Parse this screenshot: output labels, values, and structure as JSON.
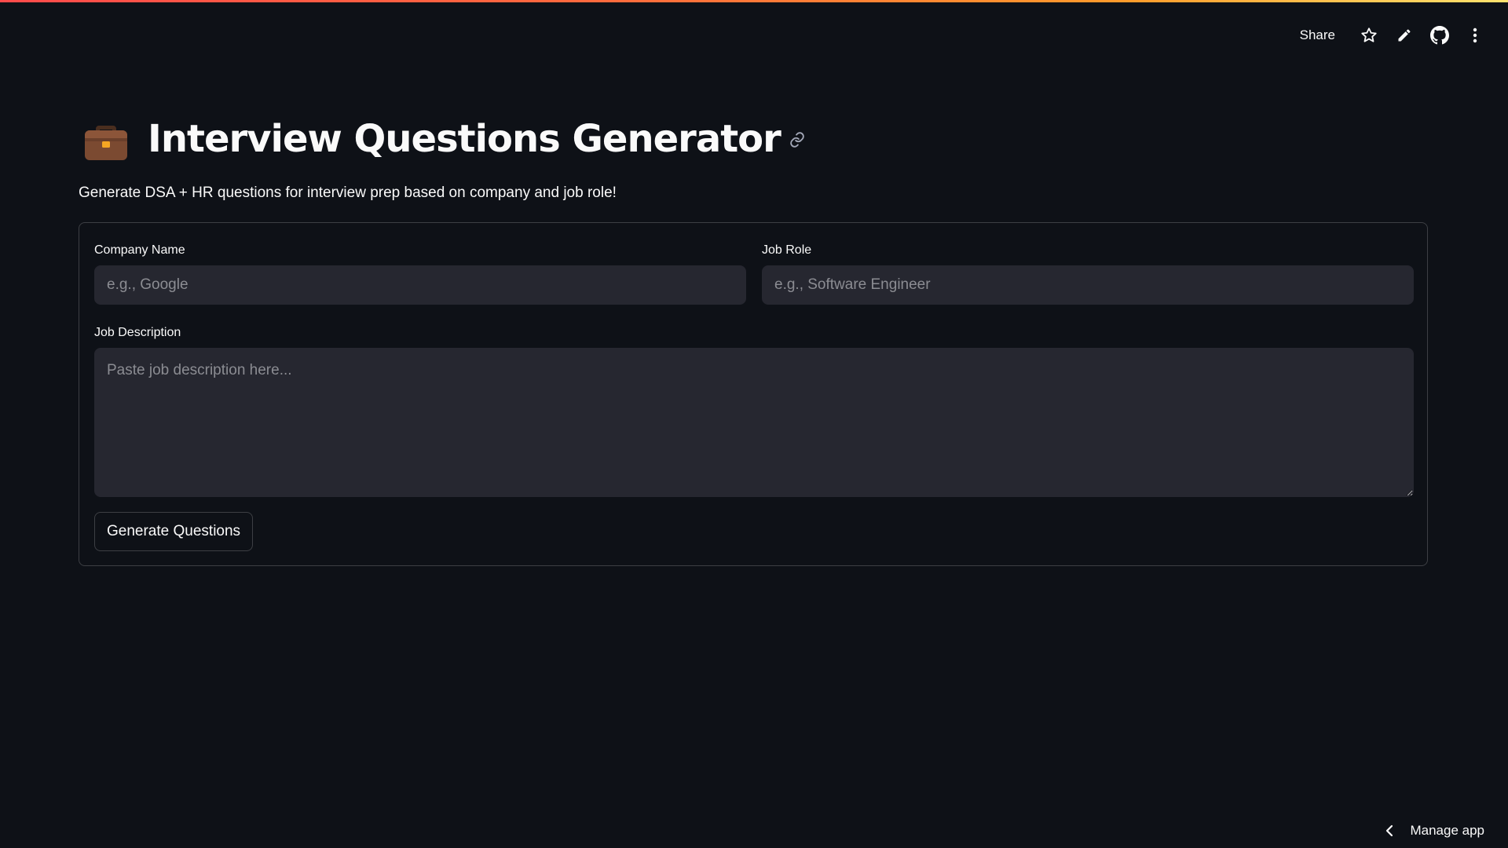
{
  "header": {
    "share_label": "Share",
    "icons": [
      "star-icon",
      "pencil-icon",
      "github-icon",
      "more-vertical-icon"
    ]
  },
  "main": {
    "title_icon": "briefcase-icon",
    "title": "Interview Questions Generator",
    "subtitle": "Generate DSA + HR questions for interview prep based on company and job role!",
    "form": {
      "company": {
        "label": "Company Name",
        "placeholder": "e.g., Google",
        "value": ""
      },
      "role": {
        "label": "Job Role",
        "placeholder": "e.g., Software Engineer",
        "value": ""
      },
      "description": {
        "label": "Job Description",
        "placeholder": "Paste job description here...",
        "value": ""
      },
      "submit_label": "Generate Questions"
    }
  },
  "footer": {
    "manage_label": "Manage app"
  },
  "colors": {
    "background": "#0e1117",
    "input_bg": "#262730",
    "text": "#fafafa",
    "accent_gradient": [
      "#ff4b4b",
      "#ffe36e"
    ]
  }
}
